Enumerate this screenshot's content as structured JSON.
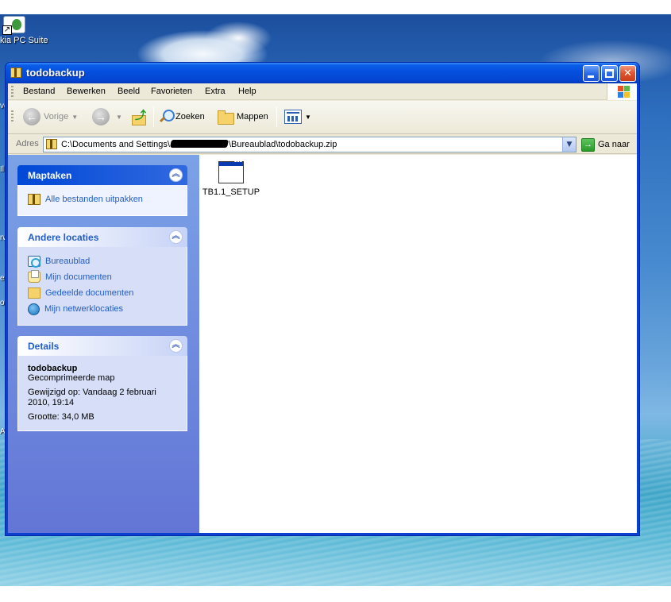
{
  "desktop": {
    "icon_label": "kia PC Suite",
    "edge_fragments": [
      "Il",
      "ve",
      "rw",
      "e",
      "o",
      "A"
    ]
  },
  "window": {
    "title": "todobackup",
    "buttons": {
      "minimize": "_",
      "maximize": "□",
      "close": "✕"
    }
  },
  "menu": [
    "Bestand",
    "Bewerken",
    "Beeld",
    "Favorieten",
    "Extra",
    "Help"
  ],
  "toolbar": {
    "back_label": "Vorige",
    "search_label": "Zoeken",
    "folders_label": "Mappen"
  },
  "address": {
    "label": "Adres",
    "path_start": "C:\\Documents and Settings\\",
    "path_end": "\\Bureaublad\\todobackup.zip",
    "go_label": "Ga naar"
  },
  "panels": {
    "tasks": {
      "title": "Maptaken",
      "items": [
        "Alle bestanden uitpakken"
      ]
    },
    "other_places": {
      "title": "Andere locaties",
      "items": [
        "Bureaublad",
        "Mijn documenten",
        "Gedeelde documenten",
        "Mijn netwerklocaties"
      ]
    },
    "details": {
      "title": "Details",
      "name": "todobackup",
      "type": "Gecomprimeerde map",
      "modified": "Gewijzigd op: Vandaag 2 februari 2010, 19:14",
      "size": "Grootte: 34,0 MB"
    }
  },
  "files": [
    {
      "name": "TB1.1_SETUP"
    }
  ]
}
